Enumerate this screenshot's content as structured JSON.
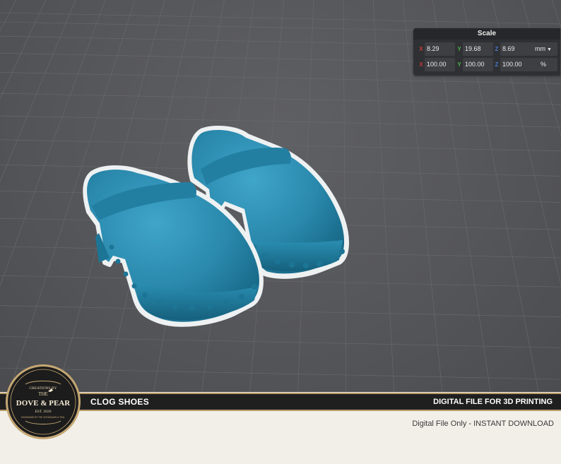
{
  "scale_panel": {
    "title": "Scale",
    "size_row": {
      "x_label": "X",
      "x": "8.29",
      "y_label": "Y",
      "y": "19.68",
      "z_label": "Z",
      "z": "8.69",
      "unit": "mm"
    },
    "percent_row": {
      "x_label": "X",
      "x": "100.00",
      "y_label": "Y",
      "y": "100.00",
      "z_label": "Z",
      "z": "100.00",
      "unit": "%"
    }
  },
  "banner": {
    "product_title": "CLOG SHOES",
    "right_title": "DIGITAL FILE FOR 3D PRINTING"
  },
  "subline": "Digital File Only - INSTANT DOWNLOAD",
  "logo": {
    "top_text": "CREATIONS BY",
    "the": "THE",
    "name": "DOVE & PEAR",
    "est": "EST. 2020",
    "tagline": "HANDMADE BY THE WYNDHAMS & TEAL"
  },
  "colors": {
    "viewport_bg": "#555659",
    "model": "#2a89ad",
    "banner_bg": "#1f1f20",
    "banner_accent": "#b79a67",
    "page_bg": "#f2efe9"
  }
}
